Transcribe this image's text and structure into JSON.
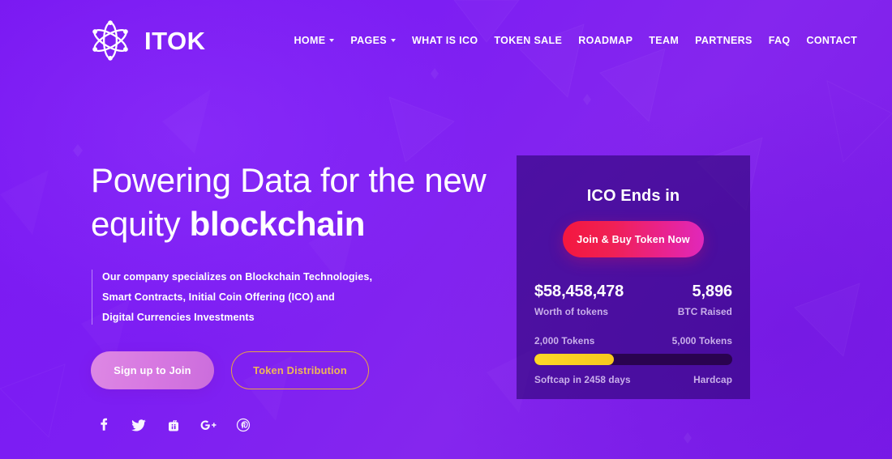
{
  "theme": {
    "background_purple": "#7d1ef3",
    "card_purple": "#2a0370",
    "accent_pink": "#d778e1",
    "accent_gold": "#e6a445",
    "accent_red": "#f4173f",
    "accent_magenta": "#e028bb",
    "progress_yellow": "#f6c81d",
    "muted_text": "#c9b0ea"
  },
  "header": {
    "brand_name": "ITOK",
    "logo_icon": "atom-icon",
    "nav": [
      {
        "label": "HOME",
        "has_dropdown": true
      },
      {
        "label": "PAGES",
        "has_dropdown": true
      },
      {
        "label": "WHAT IS ICO",
        "has_dropdown": false
      },
      {
        "label": "TOKEN SALE",
        "has_dropdown": false
      },
      {
        "label": "ROADMAP",
        "has_dropdown": false
      },
      {
        "label": "TEAM",
        "has_dropdown": false
      },
      {
        "label": "PARTNERS",
        "has_dropdown": false
      },
      {
        "label": "FAQ",
        "has_dropdown": false
      },
      {
        "label": "CONTACT",
        "has_dropdown": false
      }
    ]
  },
  "hero": {
    "headline_part1": "Powering Data for the new equity ",
    "headline_strong": "blockchain",
    "description_lines": [
      "Our company specializes on Blockchain Technologies,",
      "Smart Contracts, Initial Coin Offering (ICO) and",
      "Digital Currencies Investments"
    ],
    "primary_button": "Sign up to Join",
    "secondary_button": "Token Distribution",
    "socials": [
      {
        "name": "facebook-icon"
      },
      {
        "name": "twitter-icon"
      },
      {
        "name": "youtube-icon"
      },
      {
        "name": "google-plus-icon"
      },
      {
        "name": "pinterest-icon"
      }
    ]
  },
  "ico_card": {
    "title": "ICO Ends in",
    "cta_button": "Join & Buy Token Now",
    "stats": {
      "worth_value": "$58,458,478",
      "worth_label": "Worth of tokens",
      "btc_value": "5,896",
      "btc_label": "BTC Raised"
    },
    "progress": {
      "left_tokens": "2,000 Tokens",
      "right_tokens": "5,000 Tokens",
      "percent": 40,
      "softcap_label": "Softcap in 2458 days",
      "hardcap_label": "Hardcap"
    }
  }
}
